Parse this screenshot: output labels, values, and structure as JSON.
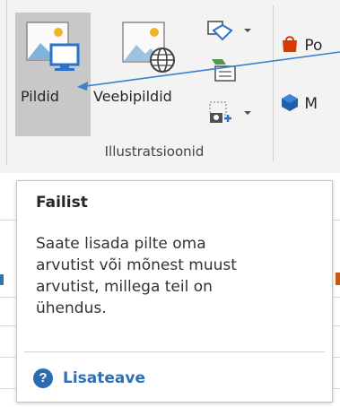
{
  "ribbon": {
    "pictures_label": "Pildid",
    "online_pictures_label": "Veebipildid",
    "group_label": "Illustratsioonid",
    "right_item_1": "Po",
    "right_item_2": "M"
  },
  "tooltip": {
    "title": "Failist",
    "body_lines": [
      "Saate lisada pilte oma",
      "arvutist või mõnest muust",
      "arvutist, millega teil on",
      "ühendus."
    ],
    "help_symbol": "?",
    "help_link": "Lisateave"
  },
  "colors": {
    "arrow": "#3a7fd0",
    "help_link": "#2e6fb5",
    "selected_button": "#c8c8c8"
  },
  "icons": {
    "pictures": "picture-monitor-icon",
    "online_pictures": "picture-globe-icon",
    "shapes": "shapes-icon",
    "smartart": "smartart-icon",
    "screenshot": "screenshot-icon",
    "store": "store-icon",
    "addins": "addins-icon",
    "help": "help-icon"
  }
}
